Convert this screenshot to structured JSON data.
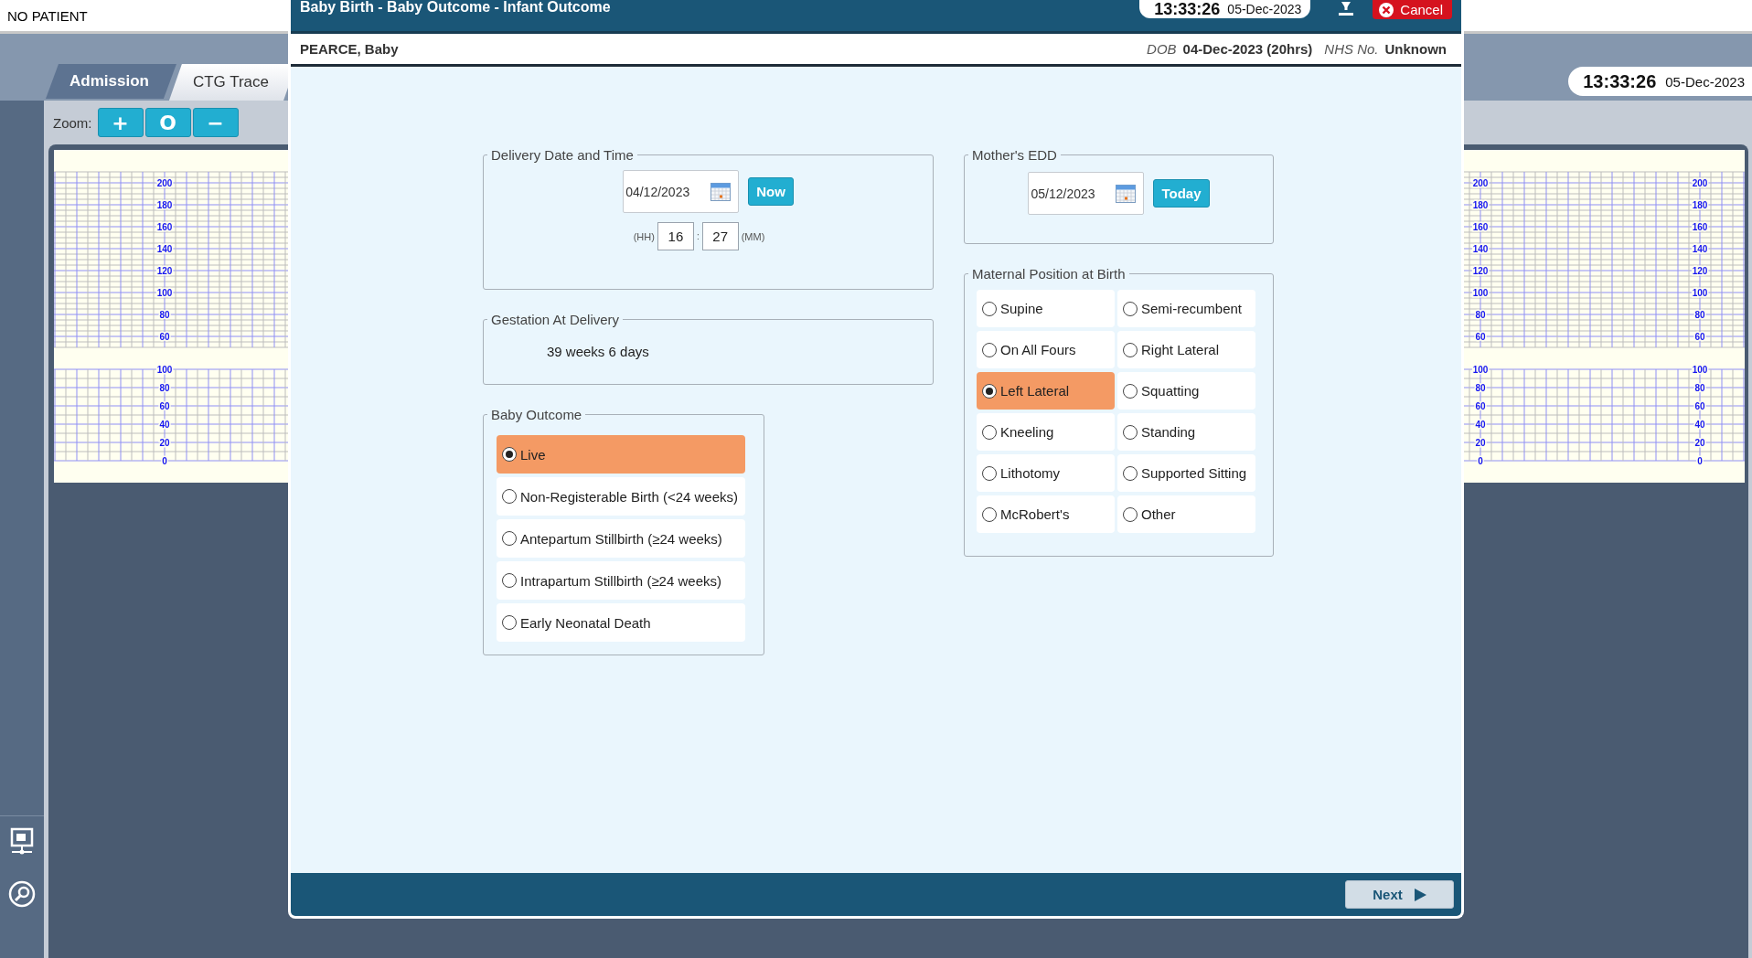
{
  "patient_bar": {
    "text": "NO PATIENT"
  },
  "tabs": [
    {
      "label": "Admission",
      "selected": false
    },
    {
      "label": "CTG Trace",
      "selected": true
    }
  ],
  "clock": {
    "time": "13:33:26",
    "date": "05-Dec-2023"
  },
  "zoom": {
    "label": "Zoom:",
    "buttons": [
      "+",
      "O",
      "−"
    ]
  },
  "ctg_strips": [
    {
      "scales": [
        {
          "fhr": [
            "200",
            "180",
            "160",
            "140",
            "120",
            "100",
            "80",
            "60"
          ],
          "toco": [
            "100",
            "80",
            "60",
            "40",
            "20",
            "0"
          ]
        }
      ]
    },
    {
      "scales": [
        {
          "fhr": [
            "200",
            "180",
            "160",
            "140",
            "120",
            "100",
            "80",
            "60"
          ],
          "toco": [
            "100",
            "80",
            "60",
            "40",
            "20",
            "0"
          ]
        },
        {
          "fhr": [
            "200",
            "180",
            "160",
            "140",
            "120",
            "100",
            "80",
            "60"
          ],
          "toco": [
            "100",
            "80",
            "60",
            "40",
            "20",
            "0"
          ]
        }
      ]
    }
  ],
  "dialog": {
    "title": "Baby Birth - Baby Outcome - Infant Outcome",
    "clock": {
      "time": "13:33:26",
      "date": "05-Dec-2023"
    },
    "cancel": "Cancel",
    "patient": {
      "name": "PEARCE, Baby",
      "dob_label": "DOB",
      "dob": "04-Dec-2023 (20hrs)",
      "nhs_label": "NHS No.",
      "nhs": "Unknown"
    },
    "delivery": {
      "title": "Delivery Date and Time",
      "date": "04/12/2023",
      "now": "Now",
      "hh_label": "(HH)",
      "hour": "16",
      "sep": ":",
      "minute": "27",
      "mm_label": "(MM)"
    },
    "gestation": {
      "title": "Gestation At Delivery",
      "value": "39 weeks 6 days"
    },
    "baby_outcome": {
      "title": "Baby Outcome",
      "options": [
        {
          "label": "Live",
          "selected": true
        },
        {
          "label": "Non-Registerable Birth  (<24 weeks)",
          "selected": false
        },
        {
          "label": "Antepartum Stillbirth (≥24 weeks)",
          "selected": false
        },
        {
          "label": "Intrapartum Stillbirth (≥24 weeks)",
          "selected": false
        },
        {
          "label": "Early Neonatal Death",
          "selected": false
        }
      ]
    },
    "edd": {
      "title": "Mother's EDD",
      "date": "05/12/2023",
      "today": "Today"
    },
    "maternal_position": {
      "title": "Maternal Position at Birth",
      "options": [
        {
          "label": "Supine",
          "selected": false
        },
        {
          "label": "Semi-recumbent",
          "selected": false
        },
        {
          "label": "On All Fours",
          "selected": false
        },
        {
          "label": "Right Lateral",
          "selected": false
        },
        {
          "label": "Left Lateral",
          "selected": true
        },
        {
          "label": "Squatting",
          "selected": false
        },
        {
          "label": "Kneeling",
          "selected": false
        },
        {
          "label": "Standing",
          "selected": false
        },
        {
          "label": "Lithotomy",
          "selected": false
        },
        {
          "label": "Supported Sitting",
          "selected": false
        },
        {
          "label": "McRobert's",
          "selected": false
        },
        {
          "label": "Other",
          "selected": false
        }
      ]
    },
    "next": "Next"
  }
}
